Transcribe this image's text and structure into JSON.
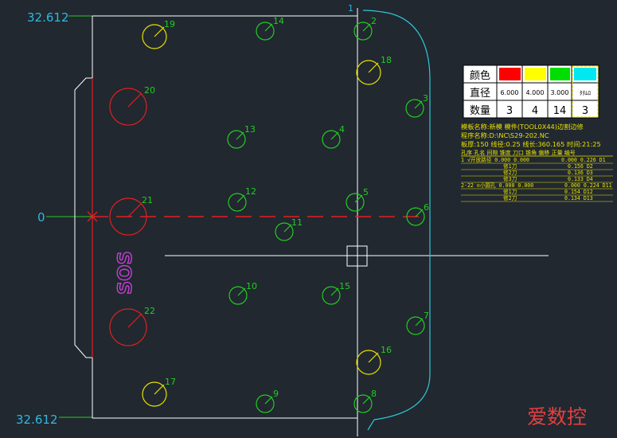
{
  "dimensions": {
    "top": "32.612",
    "bottom": "32.612",
    "origin": "0"
  },
  "edge_mark": "1",
  "part_label": "SOS",
  "watermark": "爱数控",
  "colors": {
    "background": "#212830",
    "outline": "#ffffff",
    "contour": "#2ec8d8",
    "dimension": "#2fb8e0",
    "hole_red": "#e02020",
    "hole_yellow": "#e8e000",
    "hole_green": "#22cc22",
    "text_green": "#22cc22",
    "magenta": "#d040e0",
    "info_yellow": "#e8e000",
    "watermark": "#e04040"
  },
  "holes": [
    {
      "id": "1",
      "label": "2",
      "color": "green"
    },
    {
      "id": "2",
      "label": "3",
      "color": "green"
    },
    {
      "id": "3",
      "label": "4",
      "color": "green"
    },
    {
      "id": "4",
      "label": "5",
      "color": "green"
    },
    {
      "id": "5",
      "label": "6",
      "color": "green"
    },
    {
      "id": "6",
      "label": "7",
      "color": "green"
    },
    {
      "id": "7",
      "label": "8",
      "color": "green"
    },
    {
      "id": "8",
      "label": "9",
      "color": "green"
    },
    {
      "id": "9",
      "label": "10",
      "color": "green"
    },
    {
      "id": "10",
      "label": "11",
      "color": "green"
    },
    {
      "id": "11",
      "label": "12",
      "color": "green"
    },
    {
      "id": "12",
      "label": "13",
      "color": "green"
    },
    {
      "id": "13",
      "label": "14",
      "color": "green"
    },
    {
      "id": "14",
      "label": "15",
      "color": "green"
    },
    {
      "id": "15",
      "label": "16",
      "color": "yellow"
    },
    {
      "id": "16",
      "label": "17",
      "color": "yellow"
    },
    {
      "id": "17",
      "label": "18",
      "color": "yellow"
    },
    {
      "id": "18",
      "label": "19",
      "color": "yellow"
    },
    {
      "id": "19",
      "label": "20",
      "color": "red"
    },
    {
      "id": "20",
      "label": "21",
      "color": "red"
    },
    {
      "id": "21",
      "label": "22",
      "color": "red"
    }
  ],
  "legend": {
    "row_labels": [
      "颜色",
      "直径",
      "数量"
    ],
    "columns": [
      {
        "color": "#ff0000",
        "diameter": "6.000",
        "count": "3"
      },
      {
        "color": "#ffff00",
        "diameter": "4.000",
        "count": "4"
      },
      {
        "color": "#00dd00",
        "diameter": "3.000",
        "count": "14"
      },
      {
        "color": "#00e8f0",
        "diameter": "ﾀﾀﾑﾛ",
        "count": "3"
      }
    ]
  },
  "info": {
    "lines": [
      "模板名称:新模 模件(TOOL0X44)边割边修",
      "程序名称:D:\\NC\\S29-202.NC",
      "板厚:150 线径:0.25 线长:360.165 时间:21:25",
      "孔序  孔名    间隙   锥度   刀口 锥角 偏移 正量 编号"
    ],
    "rows": [
      [
        "1  √开放路径 0.000 0.000",
        "0.000 0.226 D1"
      ],
      [
        "修1刀",
        "0.156 D2"
      ],
      [
        "修2刀",
        "0.136 D3"
      ],
      [
        "修3刀",
        "0.133 D4"
      ],
      [
        "2-22 ⊙小圆孔 0.000 0.000",
        "0.000 0.224 D11"
      ],
      [
        "修1刀",
        "0.154 D12"
      ],
      [
        "修2刀",
        "0.134 D13"
      ]
    ]
  }
}
